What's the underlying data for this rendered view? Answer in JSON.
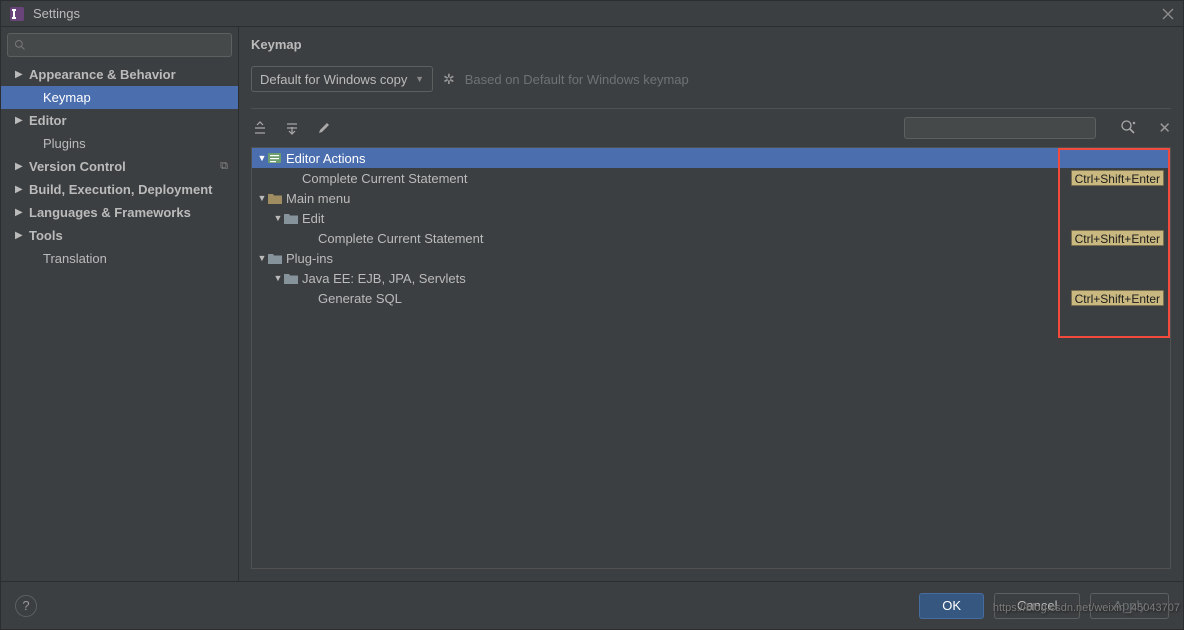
{
  "window": {
    "title": "Settings"
  },
  "sidebar": {
    "search_placeholder": "",
    "items": [
      {
        "label": "Appearance & Behavior",
        "exp": true,
        "bold": true
      },
      {
        "label": "Keymap",
        "child": true
      },
      {
        "label": "Editor",
        "exp": true,
        "bold": true
      },
      {
        "label": "Plugins",
        "child": true
      },
      {
        "label": "Version Control",
        "exp": true,
        "bold": true,
        "copy": true
      },
      {
        "label": "Build, Execution, Deployment",
        "exp": true,
        "bold": true
      },
      {
        "label": "Languages & Frameworks",
        "exp": true,
        "bold": true
      },
      {
        "label": "Tools",
        "exp": true,
        "bold": true
      },
      {
        "label": "Translation",
        "child": true
      }
    ]
  },
  "main": {
    "title": "Keymap",
    "profile": "Default for Windows copy",
    "hint": "Based on Default for Windows keymap"
  },
  "tree": {
    "rows": [
      {
        "indent": 0,
        "exp": "▼",
        "icon": "editor",
        "label": "Editor Actions",
        "sel": true
      },
      {
        "indent": 1,
        "label": "Complete Current Statement",
        "short": "Ctrl+Shift+Enter"
      },
      {
        "indent": 0,
        "exp": "▼",
        "icon": "folderopen",
        "label": "Main menu"
      },
      {
        "indent": 1,
        "exp": "▼",
        "icon": "folder",
        "label": "Edit"
      },
      {
        "indent": 2,
        "label": "Complete Current Statement",
        "short": "Ctrl+Shift+Enter"
      },
      {
        "indent": 0,
        "exp": "▼",
        "icon": "folder",
        "label": "Plug-ins"
      },
      {
        "indent": 1,
        "exp": "▼",
        "icon": "folder",
        "label": "Java EE: EJB, JPA, Servlets"
      },
      {
        "indent": 2,
        "label": "Generate SQL",
        "short": "Ctrl+Shift+Enter"
      }
    ]
  },
  "buttons": {
    "ok": "OK",
    "cancel": "Cancel",
    "apply": "Apply"
  },
  "watermark": "https://blog.csdn.net/weixin_45043707"
}
